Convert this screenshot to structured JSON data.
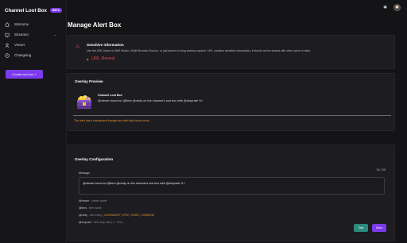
{
  "app": {
    "brand_title": "Channel Loot Box",
    "beta_badge": "BETA"
  },
  "sidebar": {
    "items": [
      {
        "label": "Welcome",
        "icon": "home-icon"
      },
      {
        "label": "Streamer",
        "icon": "screen-icon",
        "has_chevron": true
      },
      {
        "label": "Viewer",
        "icon": "user-icon"
      },
      {
        "label": "Changelog",
        "icon": "clock-icon"
      }
    ],
    "create_button": "Create loot box +"
  },
  "header": {
    "theme_icon": "sun-icon"
  },
  "page": {
    "title": "Manage Alert Box"
  },
  "sensitive": {
    "title": "Sensitive information",
    "text": "Use the URL below in OBS Studio, XSplit Browser Source, or just launch it using window capture. URL contains sensitive information, it should not be shared with other users or sites.",
    "url_reveal": "URL Reveal"
  },
  "preview": {
    "section_title": "Overlay Preview",
    "alert_title": "Channel Loot Box",
    "alert_message": "@viewer found an @item @rarity on the channel's loot box with @droprate % !",
    "note": "The alert has a transparent background with light fonts colors."
  },
  "config": {
    "section_title": "Overlay Configuration",
    "char_count": "76/ 128",
    "message_label": "Message",
    "message_value": "@viewer found an @item @rarity on the channel's loot box with @droprate % !",
    "variables": [
      {
        "name": "@viewer",
        "desc": " - viewer name"
      },
      {
        "name": "@item",
        "desc": " - item name"
      },
      {
        "name": "@rarity",
        "desc": " - item rarity ",
        "options": "( LEGENDARY | EPIC | RARE | COMMON)"
      },
      {
        "name": "@droprate",
        "desc": " - item drop rate ( 0 - 100 )"
      }
    ],
    "test_button": "Test",
    "save_button": "Save"
  },
  "colors": {
    "accent": "#7c3aed",
    "danger": "#e04a4a",
    "warning": "#e0962f",
    "teal": "#2b8a7e"
  }
}
